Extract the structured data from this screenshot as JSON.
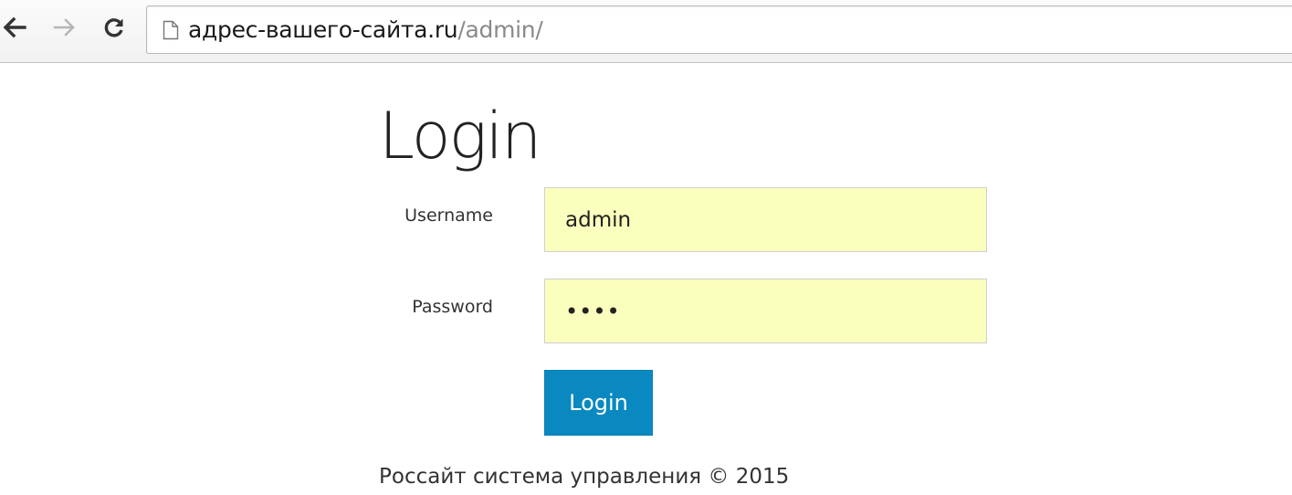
{
  "browser": {
    "url_host": "адрес-вашего-сайта.ru",
    "url_path": "/admin/",
    "back_icon": "arrow-left-icon",
    "forward_icon": "arrow-right-icon",
    "reload_icon": "reload-icon",
    "page_icon": "page-icon"
  },
  "login": {
    "title": "Login",
    "username_label": "Username",
    "username_value": "admin",
    "password_label": "Password",
    "password_value": "pass",
    "button_label": "Login"
  },
  "footer": {
    "text": "Россайт система управления © 2015"
  },
  "colors": {
    "autofill_bg": "#faffbd",
    "button_bg": "#0a89c1"
  }
}
